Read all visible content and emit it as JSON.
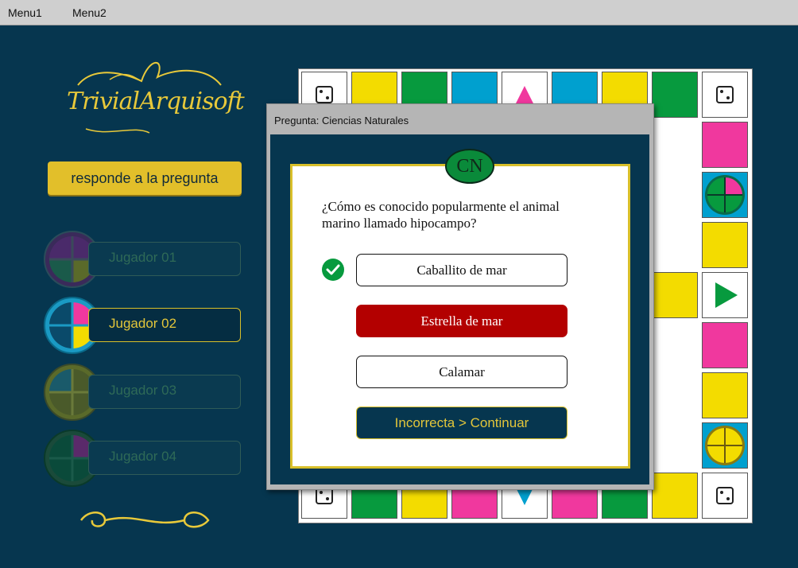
{
  "menu": {
    "items": [
      "Menu1",
      "Menu2"
    ]
  },
  "logo": {
    "text": "TrivialArquisoft"
  },
  "prompt_label": "responde a la pregunta",
  "players": [
    {
      "name": "Jugador 01",
      "active": false
    },
    {
      "name": "Jugador 02",
      "active": true
    },
    {
      "name": "Jugador 03",
      "active": false
    },
    {
      "name": "Jugador 04",
      "active": false
    }
  ],
  "dialog": {
    "title": "Pregunta: Ciencias Naturales",
    "category_code": "CN",
    "question": "¿Cómo es conocido popularmente el animal marino llamado hipocampo?",
    "answers": [
      {
        "text": "Caballito de mar",
        "state": "correct"
      },
      {
        "text": "Estrella de mar",
        "state": "wrong"
      },
      {
        "text": "Calamar",
        "state": "neutral"
      }
    ],
    "continue_label": "Incorrecta > Continuar"
  },
  "colors": {
    "background": "#06364f",
    "accent_gold": "#e2bf2a",
    "yellow": "#f3dc00",
    "green": "#079a3e",
    "blue": "#00a0cf",
    "pink": "#f0389e",
    "purple": "#6a2c8a",
    "wrong_red": "#b30000"
  }
}
